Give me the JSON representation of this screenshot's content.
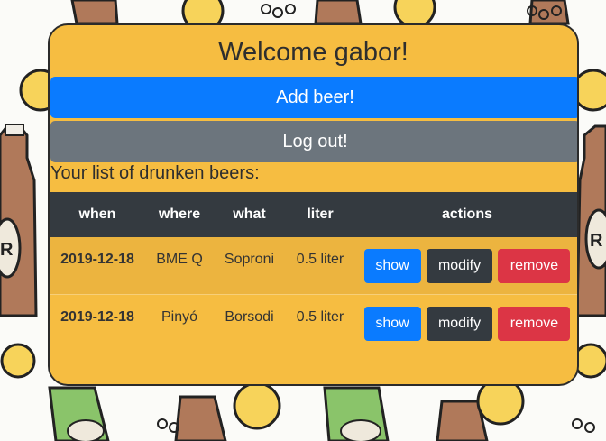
{
  "header": {
    "welcome": "Welcome gabor!"
  },
  "buttons": {
    "add": "Add beer!",
    "logout": "Log out!"
  },
  "list_title": "Your list of drunken beers:",
  "table": {
    "columns": [
      "when",
      "where",
      "what",
      "liter",
      "actions"
    ],
    "rows": [
      {
        "when": "2019-12-18",
        "where": "BME Q",
        "what": "Soproni",
        "liter": "0.5 liter",
        "actions": {
          "show": "show",
          "modify": "modify",
          "remove": "remove"
        }
      },
      {
        "when": "2019-12-18",
        "where": "Pinyó",
        "what": "Borsodi",
        "liter": "0.5 liter",
        "actions": {
          "show": "show",
          "modify": "modify",
          "remove": "remove"
        }
      }
    ]
  },
  "colors": {
    "card": "#f6bd41",
    "primary": "#0a7bff",
    "secondary": "#6c757d",
    "dark": "#343a40",
    "danger": "#dc3545"
  }
}
